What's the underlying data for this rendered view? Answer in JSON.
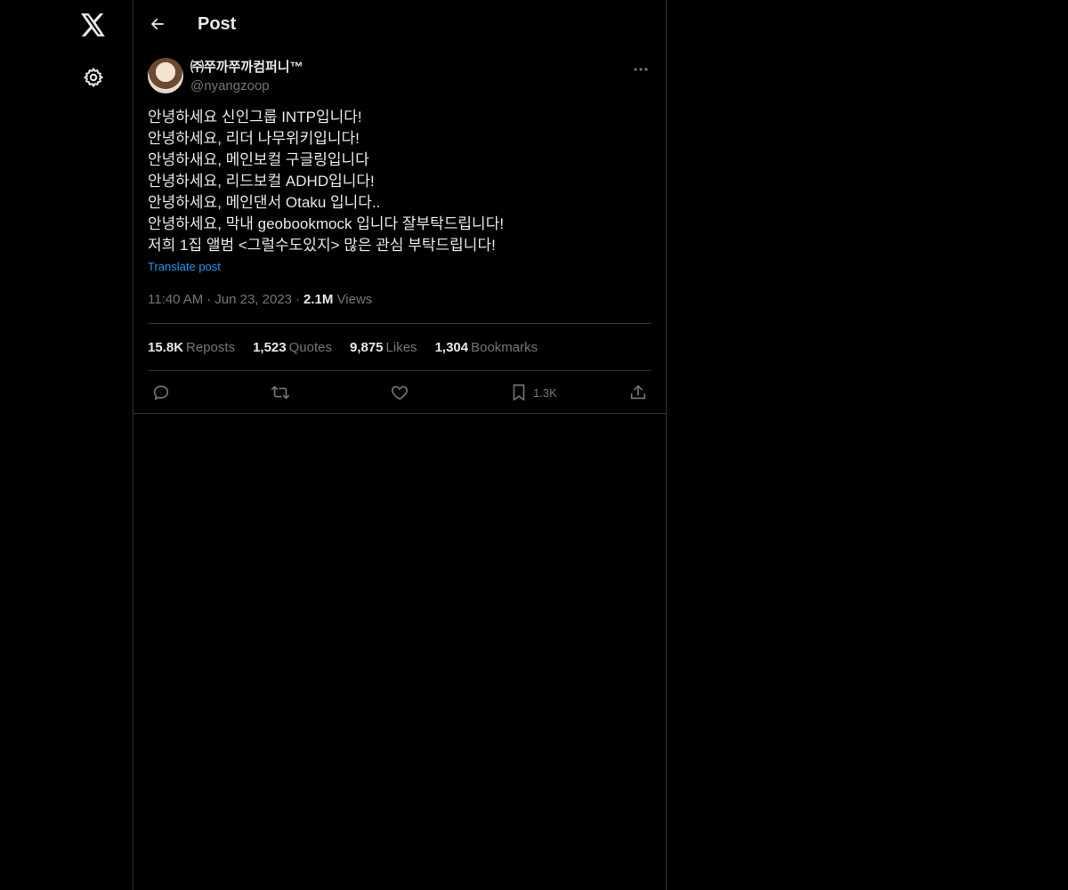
{
  "nav": {
    "logo_icon": "x-logo-icon",
    "settings_icon": "gear-icon"
  },
  "header": {
    "title": "Post",
    "back_icon": "arrow-left-icon"
  },
  "post": {
    "display_name": "㈜쭈까쭈까컴퍼니™",
    "handle": "@nyangzoop",
    "lines": [
      "안녕하세요 신인그룹 INTP입니다!",
      "안녕하세요, 리더 나무위키입니다!",
      "안녕하새요, 메인보컬 구글링입니다",
      "안녕하세요, 리드보컬 ADHD입니다!",
      "안녕하세요, 메인댄서 Otaku 입니다..",
      "안녕하세요, 막내 geobookmock 입니다 잘부탁드립니다!",
      "저희 1집 앨범 <그럴수도있지> 많은 관심 부탁드립니다!"
    ],
    "translate_label": "Translate post",
    "time": "11:40 AM",
    "date": "Jun 23, 2023",
    "views_count": "2.1M",
    "views_label": "Views",
    "stats": {
      "reposts_count": "15.8K",
      "reposts_label": "Reposts",
      "quotes_count": "1,523",
      "quotes_label": "Quotes",
      "likes_count": "9,875",
      "likes_label": "Likes",
      "bookmarks_count": "1,304",
      "bookmarks_label": "Bookmarks"
    },
    "actions": {
      "bookmark_count": "1.3K"
    }
  },
  "colors": {
    "background": "#000000",
    "text": "#e7e9ea",
    "muted": "#71767b",
    "link": "#1d9bf0",
    "border": "#2f3336"
  }
}
